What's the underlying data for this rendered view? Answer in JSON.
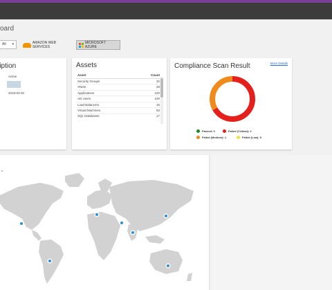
{
  "header": {
    "title": "oard"
  },
  "filter": {
    "label": "",
    "value": "All",
    "chevron": "chevron-down-icon"
  },
  "providers": [
    {
      "label": "AMAZON WEB SERVICES",
      "icon": "aws-cloud-icon",
      "selected": false
    },
    {
      "label": "MICROSOFT AZURE",
      "icon": "microsoft-logo-icon",
      "selected": true
    }
  ],
  "subscription": {
    "title": "ription",
    "status": "Active",
    "date": "2019-03-02"
  },
  "assets": {
    "title": "Assets",
    "columns": [
      "Asset",
      "Count"
    ],
    "rows": [
      [
        "Security Groups",
        "32"
      ],
      [
        "VNets",
        "28"
      ],
      [
        "Applications",
        "100"
      ],
      [
        "AD Users",
        "100"
      ],
      [
        "Load Balancers",
        "16"
      ],
      [
        "Virtual Machines",
        "83"
      ],
      [
        "SQL Databases",
        "17"
      ]
    ]
  },
  "compliance": {
    "title": "Compliance Scan Result",
    "more_link": "More Details",
    "legend": [
      {
        "label": "Passed: 0",
        "color": "#1e8a1e",
        "value": 0
      },
      {
        "label": "Failed (Critical): 2",
        "color": "#e3201c",
        "value": 2
      },
      {
        "label": "Failed (Medium): 1",
        "color": "#f08a1c",
        "value": 1
      },
      {
        "label": "Failed (Low): 0",
        "color": "#f4e04a",
        "value": 0
      }
    ]
  },
  "map": {
    "title": "s"
  },
  "colors": {
    "brand": "#7b3f98",
    "topbar": "#3c3c3c",
    "marker": "#2f8fd6",
    "land": "#d2d2d2"
  }
}
